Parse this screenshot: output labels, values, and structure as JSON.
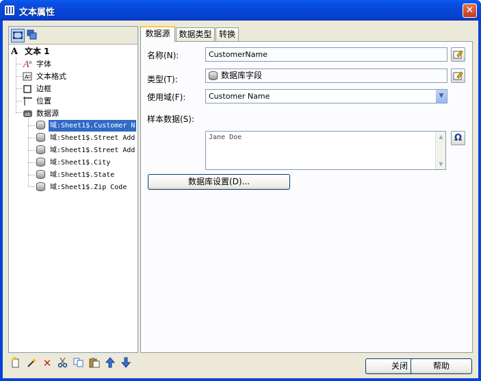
{
  "window": {
    "title": "文本属性",
    "close_glyph": "✕"
  },
  "tree": {
    "root": {
      "label": "文本 1",
      "icon": "A"
    },
    "items": [
      {
        "label": "字体",
        "icon": "font-icon"
      },
      {
        "label": "文本格式",
        "icon": "text-format-icon"
      },
      {
        "label": "边框",
        "icon": "border-icon"
      },
      {
        "label": "位置",
        "icon": "position-icon"
      },
      {
        "label": "数据源",
        "icon": "datasource-icon"
      }
    ],
    "fields": [
      "域:Sheet1$.Customer N",
      "域:Sheet1$.Street Add",
      "域:Sheet1$.Street Add",
      "域:Sheet1$.City",
      "域:Sheet1$.State",
      "域:Sheet1$.Zip Code"
    ]
  },
  "tabs": [
    "数据源",
    "数据类型",
    "转换"
  ],
  "form": {
    "name_label": "名称(N):",
    "name_value": "CustomerName",
    "type_label": "类型(T):",
    "type_value": "数据库字段",
    "domain_label": "使用域(F):",
    "domain_value": "Customer Name",
    "sample_label": "样本数据(S):",
    "sample_value": "Jane Doe",
    "db_settings_button": "数据库设置(D)...",
    "omega_glyph": "Ω"
  },
  "footer": {
    "close_button": "关闭",
    "help_button": "帮助"
  },
  "colors": {
    "titlebar": "#0846d8",
    "selection": "#316ac5",
    "dialog_bg": "#ece9d8"
  }
}
